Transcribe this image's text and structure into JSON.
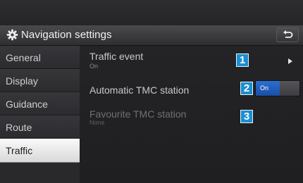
{
  "header": {
    "title": "Navigation settings",
    "icon": "gear-icon",
    "back_icon": "back-arrow-icon"
  },
  "sidebar": {
    "items": [
      {
        "label": "General",
        "selected": false
      },
      {
        "label": "Display",
        "selected": false
      },
      {
        "label": "Guidance",
        "selected": false
      },
      {
        "label": "Route",
        "selected": false
      },
      {
        "label": "Traffic",
        "selected": true
      }
    ]
  },
  "content": {
    "rows": [
      {
        "title": "Traffic event",
        "subtitle": "On",
        "badge": "1",
        "control": "chevron-right-icon",
        "enabled": true
      },
      {
        "title": "Automatic TMC station",
        "badge": "2",
        "toggle": {
          "label": "On",
          "state": "on"
        },
        "enabled": true
      },
      {
        "title": "Favourite TMC station",
        "subtitle": "None",
        "badge": "3",
        "enabled": false
      }
    ]
  },
  "colors": {
    "badge": "#1b8ed0",
    "toggle_on": "#2a6fd0",
    "selected_item": "#f0f0f0"
  }
}
